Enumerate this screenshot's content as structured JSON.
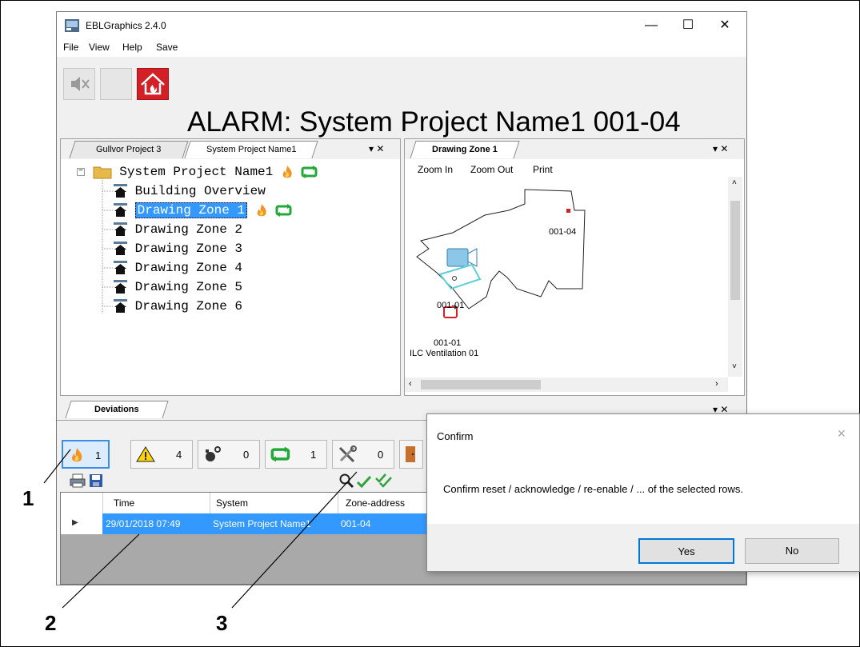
{
  "window": {
    "title": "EBLGraphics 2.4.0",
    "minimize": "—",
    "maximize": "☐",
    "close": "✕"
  },
  "menu": [
    "File",
    "View",
    "Help",
    "Save"
  ],
  "alarm_text": "ALARM: System Project Name1 001-04",
  "left_panel": {
    "tabs": [
      "Gullvor Project 3",
      "System Project Name1"
    ],
    "pin": "▾ ✕",
    "tree": {
      "root": "System Project Name1",
      "children": [
        "Building Overview",
        "Drawing Zone 1",
        "Drawing Zone 2",
        "Drawing Zone 3",
        "Drawing Zone 4",
        "Drawing Zone 5",
        "Drawing Zone 6"
      ],
      "selected_index": 1
    }
  },
  "right_panel": {
    "tab": "Drawing Zone 1",
    "pin": "▾ ✕",
    "toolbar": [
      "Zoom In",
      "Zoom Out",
      "Print"
    ],
    "labels": {
      "point_a": "001-04",
      "point_b": "001-01",
      "vent_id": "001-01",
      "vent_name": "ILC Ventilation 01"
    }
  },
  "deviations": {
    "tab": "Deviations",
    "pin": "▾ ✕",
    "counters": [
      "1",
      "4",
      "0",
      "1",
      "0"
    ],
    "columns": [
      "Time",
      "System",
      "Zone-address"
    ],
    "rows": [
      {
        "time": "29/01/2018 07:49",
        "system": "System Project Name1",
        "zone": "001-04"
      }
    ]
  },
  "dialog": {
    "title": "Confirm",
    "close": "✕",
    "message": "Confirm reset / acknowledge / re-enable / ... of the selected rows.",
    "yes": "Yes",
    "no": "No"
  },
  "callouts": [
    "1",
    "2",
    "3"
  ],
  "colors": {
    "selection": "#3399ff",
    "alarm_red": "#d32027",
    "ok_green": "#22a93a"
  }
}
